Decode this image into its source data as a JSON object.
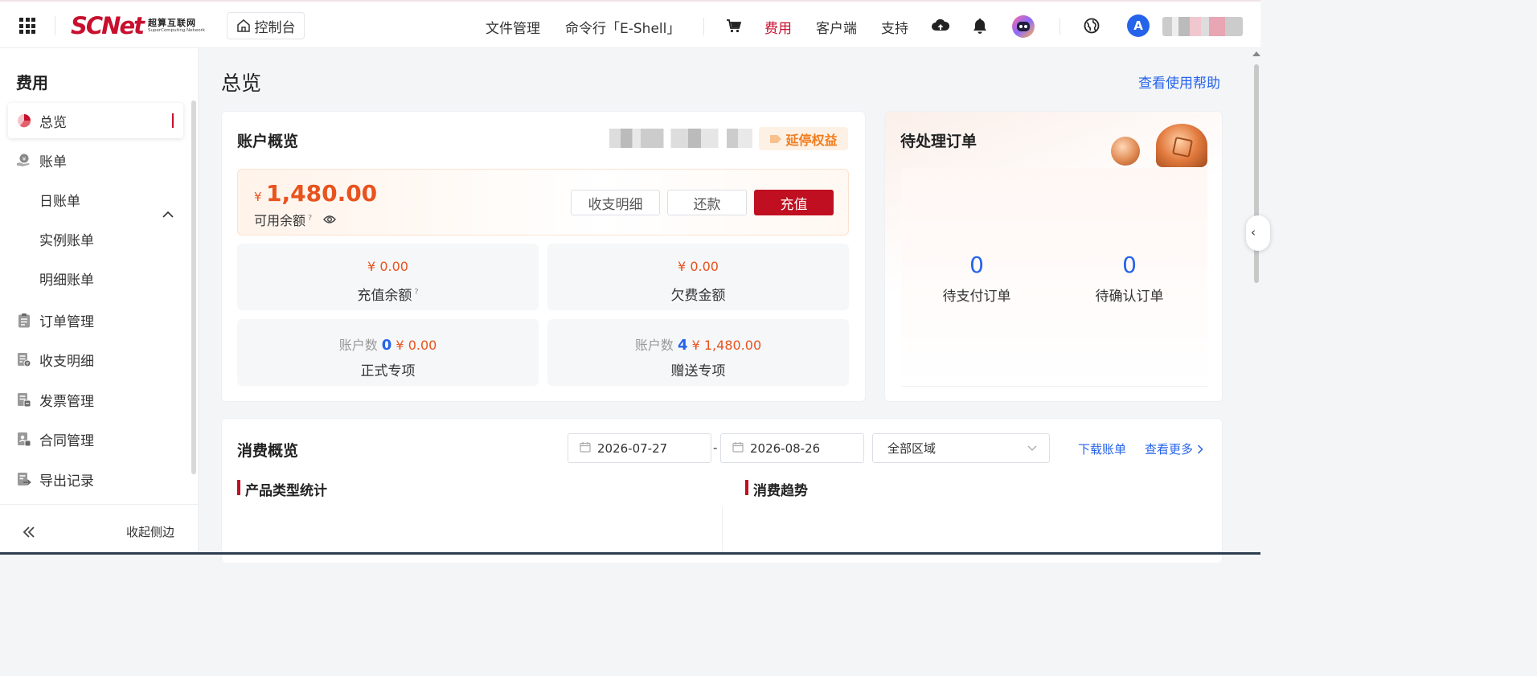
{
  "topbar": {
    "logo_main": "SCNet",
    "logo_cn": "超算互联网",
    "logo_en": "SuperComputing Network",
    "console_label": "控制台",
    "nav": {
      "files": "文件管理",
      "eshell": "命令行「E-Shell」",
      "fees": "费用",
      "client": "客户端",
      "support": "支持"
    },
    "avatar_letter": "A",
    "accent_color": "#c8102e"
  },
  "sidebar": {
    "title": "费用",
    "items": {
      "overview": "总览",
      "bills": "账单",
      "daily_bill": "日账单",
      "instance_bill": "实例账单",
      "detail_bill": "明细账单",
      "orders": "订单管理",
      "income_expense": "收支明细",
      "invoices": "发票管理",
      "contracts": "合同管理",
      "exports": "导出记录"
    },
    "collapse_label": "收起侧边"
  },
  "main": {
    "page_title": "总览",
    "help_link": "查看使用帮助",
    "account": {
      "title": "账户概览",
      "rights_tag": "延停权益",
      "currency": "¥",
      "balance": "1,480.00",
      "balance_label": "可用余额",
      "btn_detail": "收支明细",
      "btn_repay": "还款",
      "btn_recharge": "充值",
      "recharge_balance_value": "¥ 0.00",
      "recharge_balance_label": "充值余额",
      "arrears_value": "¥ 0.00",
      "arrears_label": "欠费金额",
      "formal_count_label": "账户数",
      "formal_count": "0",
      "formal_amount": "¥ 0.00",
      "formal_label": "正式专项",
      "gift_count_label": "账户数",
      "gift_count": "4",
      "gift_amount": "¥ 1,480.00",
      "gift_label": "赠送专项"
    },
    "pending": {
      "title": "待处理订单",
      "unpaid_count": "0",
      "unpaid_label": "待支付订单",
      "unconfirmed_count": "0",
      "unconfirmed_label": "待确认订单"
    },
    "consumption": {
      "title": "消费概览",
      "date_start": "2026-07-27",
      "date_sep": "-",
      "date_end": "2026-08-26",
      "region": "全部区域",
      "download_link": "下载账单",
      "more_link": "查看更多",
      "product_stats": "产品类型统计",
      "trend": "消费趋势"
    }
  }
}
